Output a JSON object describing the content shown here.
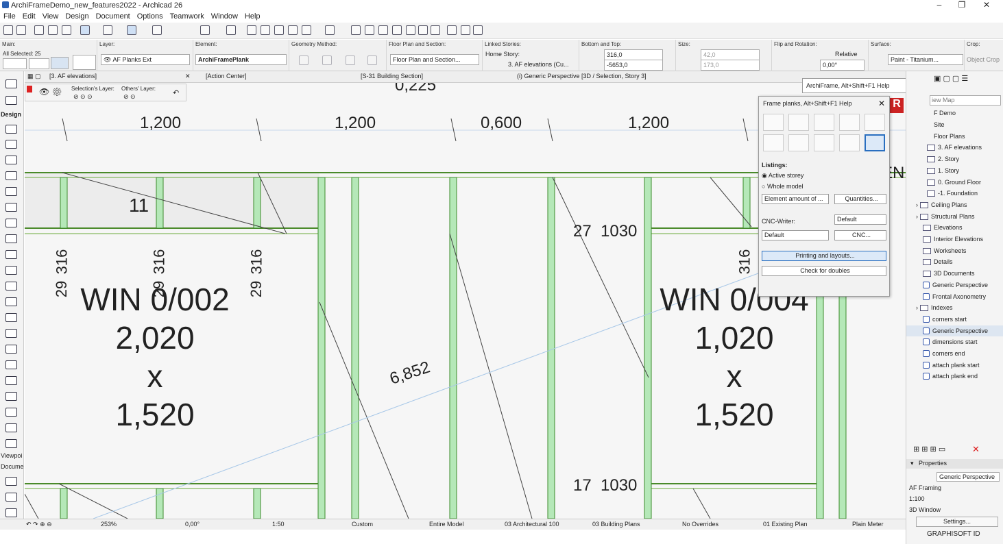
{
  "window": {
    "title": "ArchiFrameDemo_new_features2022 - Archicad 26",
    "controls": [
      "–",
      "❐",
      "✕"
    ]
  },
  "menu": [
    "File",
    "Edit",
    "View",
    "Design",
    "Document",
    "Options",
    "Teamwork",
    "Window",
    "Help"
  ],
  "infobox": {
    "main_label": "Main:",
    "main_value": "All Selected: 25",
    "layer_label": "Layer:",
    "layer_value": "AF Planks Ext",
    "element_label": "Element:",
    "element_value": "ArchiFramePlank",
    "geometry_label": "Geometry Method:",
    "floorplan_label": "Floor Plan and Section:",
    "floorplan_value": "Floor Plan and Section...",
    "linked_label": "Linked Stories:",
    "home_story_label": "Home Story:",
    "home_story_value": "3. AF elevations (Cu...",
    "bottomtop_label": "Bottom and Top:",
    "bottom_value": "316,0",
    "top_value": "-5653,0",
    "size_label": "Size:",
    "size_w": "42,0",
    "size_h": "173,0",
    "flip_label": "Flip and Rotation:",
    "relative_label": "Relative",
    "rotation_value": "0,00°",
    "surface_label": "Surface:",
    "surface_value": "Paint - Titanium...",
    "crop_label": "Crop:",
    "crop_value": "Object Crop"
  },
  "tabs": [
    "[3. AF elevations]",
    "[Action Center]",
    "[S-31 Building Section]",
    "(i) Generic Perspective [3D / Selection, Story 3]"
  ],
  "layerbar": {
    "selection_label": "Selection's Layer:",
    "others_label": "Others' Layer:"
  },
  "toolbox": {
    "design_label": "Design",
    "viewpoint_label": "Viewpoi",
    "document_label": "Docume"
  },
  "drawing": {
    "dimensions": [
      "1,200",
      "1,200",
      "0,600",
      "1,200"
    ],
    "top_partial": "0,225",
    "number_11": "11",
    "vert_labels": [
      "316",
      "316",
      "316",
      "316"
    ],
    "vert_labels2": [
      "29",
      "29",
      "29"
    ],
    "win1": [
      "WIN 0/002",
      "2,020",
      "x",
      "1,520"
    ],
    "win2": [
      "WIN 0/004",
      "1,020",
      "x",
      "1,520"
    ],
    "diag_dim": "6,852",
    "label_27": "27",
    "label_1030a": "1030",
    "label_17": "17",
    "label_1030b": "1030",
    "partial_en": "EN"
  },
  "archihelp": {
    "title": "ArchiFrame, Alt+Shift+F1 Help"
  },
  "palette": {
    "title": "Frame planks, Alt+Shift+F1 Help",
    "listings_label": "Listings:",
    "radio_active": "Active storey",
    "radio_whole": "Whole model",
    "element_amount": "Element amount of ...",
    "quantities": "Quantities...",
    "cnc_writer_label": "CNC-Writer:",
    "cnc_writer_value": "Default",
    "default2": "Default",
    "cnc": "CNC...",
    "printing": "Printing and layouts...",
    "check_doubles": "Check for doubles"
  },
  "navigator": {
    "search_placeholder": "iew Map",
    "items": [
      "F Demo",
      "Site",
      "Floor Plans",
      "3. AF elevations",
      "2. Story",
      "1. Story",
      "0. Ground Floor",
      "-1. Foundation",
      "Ceiling Plans",
      "Structural Plans",
      "Elevations",
      "Interior Elevations",
      "Worksheets",
      "Details",
      "3D Documents",
      "Generic Perspective",
      "Frontal Axonometry",
      "Indexes",
      "corners start",
      "Generic Perspective",
      "dimensions start",
      "corners end",
      "attach plank start",
      "attach plank end"
    ],
    "properties_label": "Properties",
    "prop_name": "Generic Perspective",
    "prop_rows": [
      "AF Framing",
      "1:100",
      "3D Window"
    ],
    "settings": "Settings...",
    "brand": "GRAPHISOFT ID"
  },
  "statusbar": {
    "zoom": "253%",
    "angle": "0,00°",
    "scale": "1:50",
    "custom": "Custom",
    "model": "Entire Model",
    "pen": "03 Architectural 100",
    "plans": "03 Building Plans",
    "overrides": "No Overrides",
    "existing": "01 Existing Plan",
    "meter": "Plain Meter"
  }
}
